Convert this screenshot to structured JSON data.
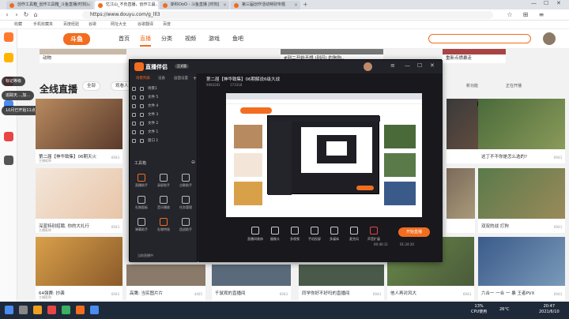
{
  "browser": {
    "tabs": [
      {
        "label": "创作工具箱_创作工具箱_斗鱼直播(时刻)",
        "active": false
      },
      {
        "label": "忆江山_不负直播，创作工具..",
        "active": true
      },
      {
        "label": "斯科OoO - 斗鱼直播 [时刻]",
        "active": false
      },
      {
        "label": "第三届创作活动特别专题",
        "active": false
      }
    ],
    "url": "https://www.douyu.com/g_lll3",
    "favorites": [
      "收藏",
      "手机收藏夹",
      "百度经验",
      "谷歌",
      "网址大全",
      "谷歌翻译",
      "百度"
    ]
  },
  "site": {
    "logo": "斗鱼",
    "nav": [
      "首页",
      "直播",
      "分类",
      "视频",
      "游戏",
      "鱼吧"
    ],
    "top_cards": [
      {
        "title": "动物",
        "sub": ""
      },
      {
        "title": "老雨 全线",
        "sub": ""
      },
      {
        "title": "",
        "sub": ""
      },
      {
        "title": "#别二开始不想 (别闪) 的狗狗..",
        "sub": ""
      },
      {
        "title": "重新点燃暴走",
        "sub": ""
      }
    ],
    "live_title": "全线直播",
    "categories": [
      "全部",
      "观看人数",
      "最新开播"
    ],
    "notifications": [
      "标记等级",
      "追踪天...,加...",
      "10月已开始11点, 开开,没有信息"
    ],
    "right_panel": {
      "labels": [
        "新功能",
        "正在开播"
      ]
    },
    "left_col_cards": [
      {
        "title": "第二届【神华致集】06期天火",
        "sub": "主播昵称",
        "cnt": "6943"
      },
      {
        "title": "深蓝特别招聘, 你的大礼行",
        "sub": "主播昵称",
        "cnt": "6943"
      },
      {
        "title": "64强赛: 抄袭",
        "sub": "主播昵称",
        "cnt": "6943"
      }
    ],
    "right_col_cards": [
      {
        "title": "瑾丁秀 天成",
        "cnt": "6943",
        "badge": "1080P 60"
      },
      {
        "title": "这丁不不你是怎么选的?",
        "cnt": "6943",
        "badge": ""
      },
      {
        "title": "狐宝宝",
        "cnt": "6943",
        "badge": "1080P 30"
      },
      {
        "title": "双双的战 打狗",
        "cnt": "6943",
        "badge": ""
      },
      {
        "title": "他人再对风大",
        "cnt": "6943",
        "badge": ""
      },
      {
        "title": "六合一 一合 一 暴 王者PVX",
        "cnt": "6943",
        "badge": ""
      }
    ],
    "bottom_row": [
      {
        "title": "高鹰: 当实图片片",
        "cnt": "4405"
      },
      {
        "title": "千鼠观的直播间",
        "cnt": "6943"
      },
      {
        "title": "同学你好不好吗的直播间",
        "cnt": "6943"
      }
    ]
  },
  "stream_app": {
    "name": "直播伴侣",
    "version": "正式版",
    "left_tabs": [
      "场景列表",
      "设备",
      "画面设置"
    ],
    "scenes": [
      "场景1",
      "文件 5",
      "文件 4",
      "文件 3",
      "文件 2",
      "文件 1",
      "窗口 1"
    ],
    "tools_label": "工具箱",
    "tools": [
      "直播助手",
      "录屏助手",
      "点歌助手",
      "礼物面板",
      "音乐播放",
      "任务管理",
      "弹幕助手",
      "礼物特效",
      "团战助手"
    ],
    "room_title": "第二届【神华致集】06期解说6级大战",
    "room_id": "9083281",
    "viewers": "173318",
    "bottom_tools": [
      "直播间装饰",
      "摄像头",
      "多视频",
      "手机投屏",
      "多媒体",
      "麦克风",
      "声音扩展"
    ],
    "timers": [
      "00:40:11",
      "01:24:20"
    ],
    "start_label": "开始直播",
    "status_text": "当前直播中"
  },
  "taskbar": {
    "cpu": "13%",
    "cpu_label": "CPU使用",
    "temp": "26°C",
    "time": "20:47",
    "date": "2021/6/10"
  },
  "colors": {
    "accent": "#f26d1f",
    "taskbar": "#1e2a3a"
  }
}
